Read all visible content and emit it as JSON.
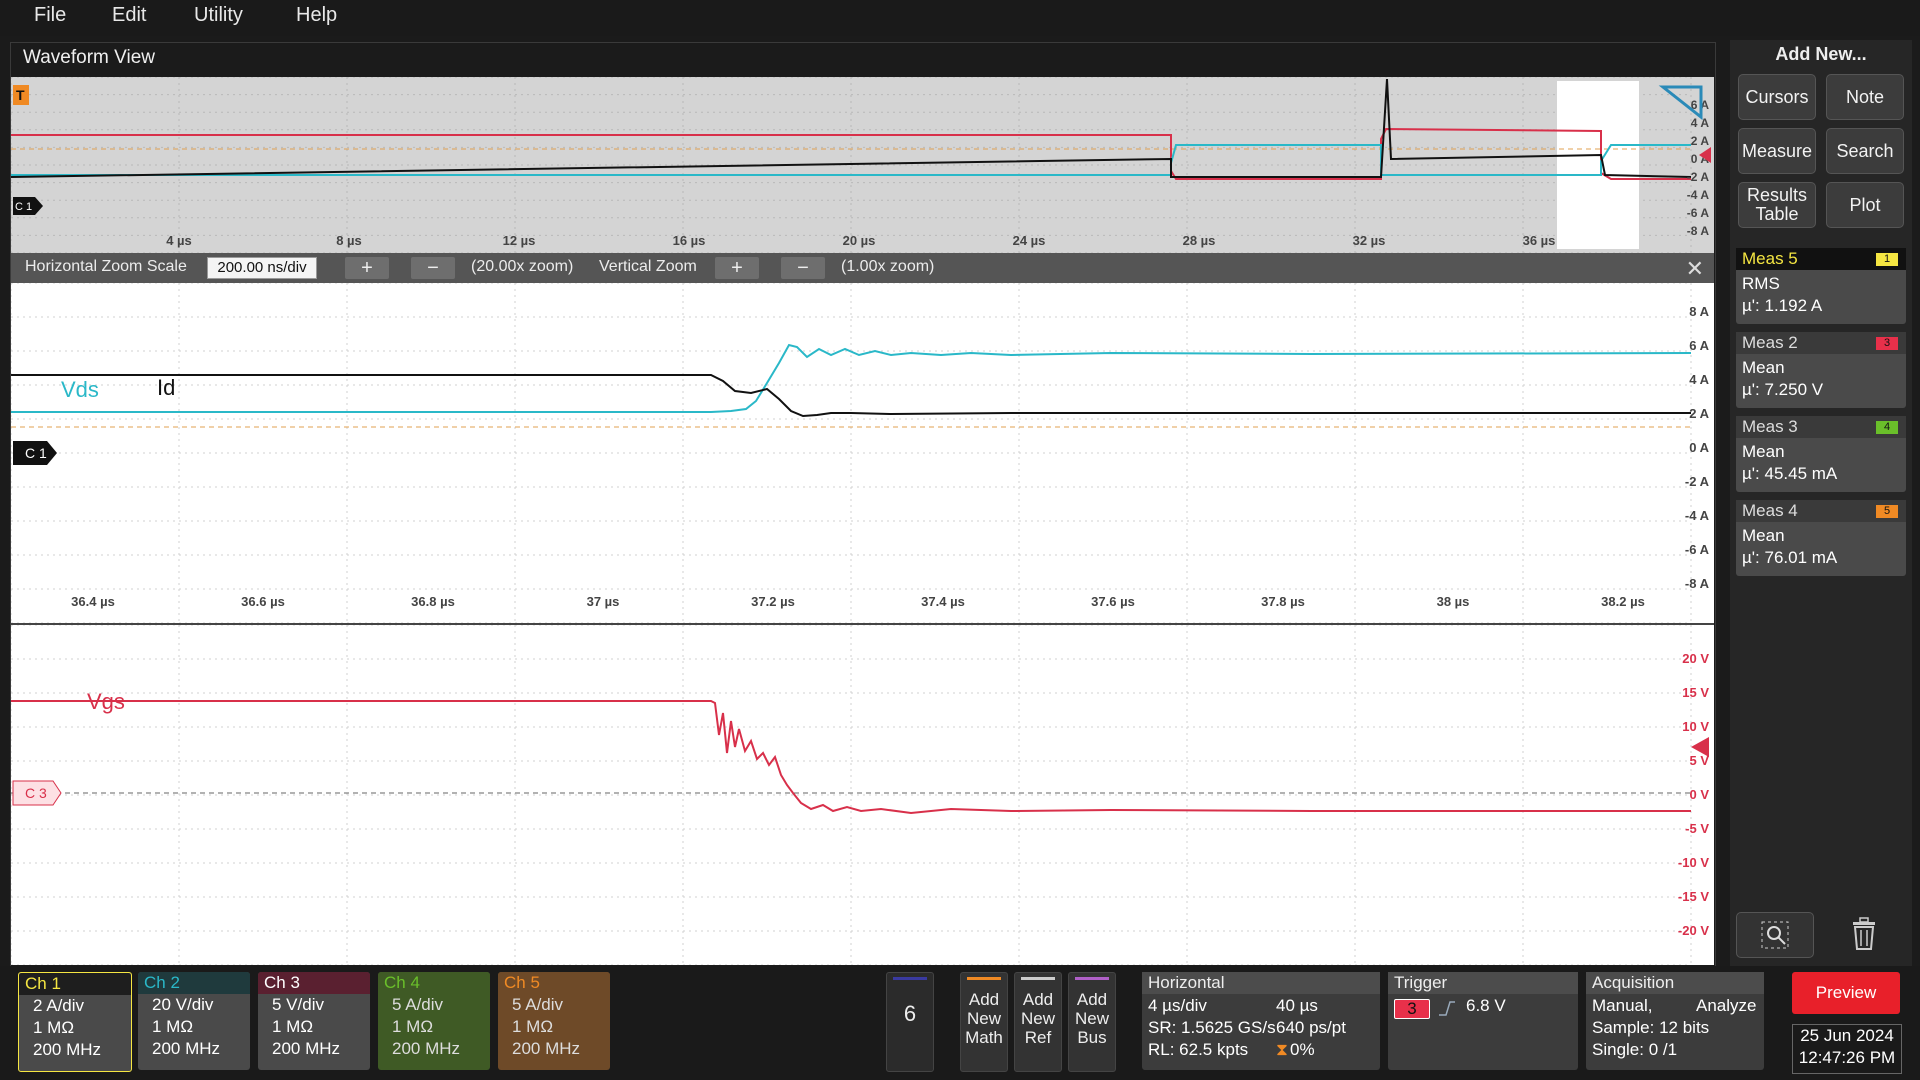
{
  "menu": {
    "file": "File",
    "edit": "Edit",
    "utility": "Utility",
    "help": "Help"
  },
  "waveform_view": {
    "title": "Waveform View",
    "overview": {
      "time_ticks": [
        "4 µs",
        "8 µs",
        "12 µs",
        "16 µs",
        "20 µs",
        "24 µs",
        "28 µs",
        "32 µs",
        "36 µs"
      ],
      "amp_ticks": [
        "6 A",
        "4 A",
        "2 A",
        "0 A",
        "-2 A",
        "-4 A",
        "-6 A",
        "-8 A"
      ],
      "trigger_marker": "T",
      "ch_marker": "C 1"
    },
    "zoom": {
      "h_label": "Horizontal Zoom Scale",
      "h_value": "200.00 ns/div",
      "plus": "+",
      "minus": "−",
      "h_zoom": "(20.00x zoom)",
      "v_label": "Vertical Zoom",
      "v_zoom": "(1.00x zoom)",
      "close": "✕"
    },
    "plot1": {
      "label_vds": "Vds",
      "label_id": "Id",
      "ch_marker": "C 1",
      "time_ticks": [
        "36.4 µs",
        "36.6 µs",
        "36.8 µs",
        "37 µs",
        "37.2 µs",
        "37.4 µs",
        "37.6 µs",
        "37.8 µs",
        "38 µs",
        "38.2 µs"
      ],
      "amp_ticks": [
        "8 A",
        "6 A",
        "4 A",
        "2 A",
        "0 A",
        "-2 A",
        "-4 A",
        "-6 A",
        "-8 A"
      ]
    },
    "plot2": {
      "label_vgs": "Vgs",
      "ch_marker": "C 3",
      "volt_ticks": [
        "20 V",
        "15 V",
        "10 V",
        "5 V",
        "0 V",
        "-5 V",
        "-10 V",
        "-15 V",
        "-20 V"
      ]
    }
  },
  "sidebar": {
    "add_new": "Add New...",
    "cursors": "Cursors",
    "note": "Note",
    "measure": "Measure",
    "search": "Search",
    "results_table_1": "Results",
    "results_table_2": "Table",
    "plot": "Plot",
    "measurements": [
      {
        "name": "Meas 5",
        "badge": "1",
        "type": "RMS",
        "value": "µ': 1.192 A",
        "color": "#f5e642"
      },
      {
        "name": "Meas 2",
        "badge": "3",
        "type": "Mean",
        "value": "µ': 7.250 V",
        "color": "#e8304a"
      },
      {
        "name": "Meas 3",
        "badge": "4",
        "type": "Mean",
        "value": "µ': 45.45 mA",
        "color": "#6abf2a"
      },
      {
        "name": "Meas 4",
        "badge": "5",
        "type": "Mean",
        "value": "µ': 76.01 mA",
        "color": "#f08a24"
      }
    ]
  },
  "channels": [
    {
      "name": "Ch 1",
      "scale": "2 A/div",
      "imp": "1 MΩ",
      "bw": "200 MHz",
      "color": "#f5e642",
      "head_bg": "#1e1e1e"
    },
    {
      "name": "Ch 2",
      "scale": "20 V/div",
      "imp": "1 MΩ",
      "bw": "200 MHz",
      "color": "#2ab8c8",
      "head_bg": "#1f3a3d"
    },
    {
      "name": "Ch 3",
      "scale": "5 V/div",
      "imp": "1 MΩ",
      "bw": "200 MHz",
      "color": "#ffffff",
      "head_bg": "#5a2030"
    },
    {
      "name": "Ch 4",
      "scale": "5 A/div",
      "imp": "1 MΩ",
      "bw": "200 MHz",
      "color": "#6abf2a",
      "head_bg": "#3f5a25"
    },
    {
      "name": "Ch 5",
      "scale": "5 A/div",
      "imp": "1 MΩ",
      "bw": "200 MHz",
      "color": "#f08a24",
      "head_bg": "#6e4a28"
    }
  ],
  "bottom": {
    "channel_more": "6",
    "add_math": [
      "Add",
      "New",
      "Math"
    ],
    "add_ref": [
      "Add",
      "New",
      "Ref"
    ],
    "add_bus": [
      "Add",
      "New",
      "Bus"
    ],
    "horizontal": {
      "title": "Horizontal",
      "scale": "4 µs/div",
      "pos": "40 µs",
      "sr": "SR: 1.5625 GS/s",
      "pt": "640 ps/pt",
      "rl": "RL: 62.5 kpts",
      "pct": "0%"
    },
    "trigger": {
      "title": "Trigger",
      "source": "3",
      "level": "6.8 V"
    },
    "acquisition": {
      "title": "Acquisition",
      "mode": "Manual,",
      "analyze": "Analyze",
      "sample": "Sample: 12 bits",
      "single": "Single: 0 /1"
    },
    "preview": "Preview",
    "date": "25 Jun 2024",
    "time": "12:47:26 PM"
  },
  "colors": {
    "ch1": "#111111",
    "ch2": "#2ab8c8",
    "ch3": "#d8304a"
  }
}
